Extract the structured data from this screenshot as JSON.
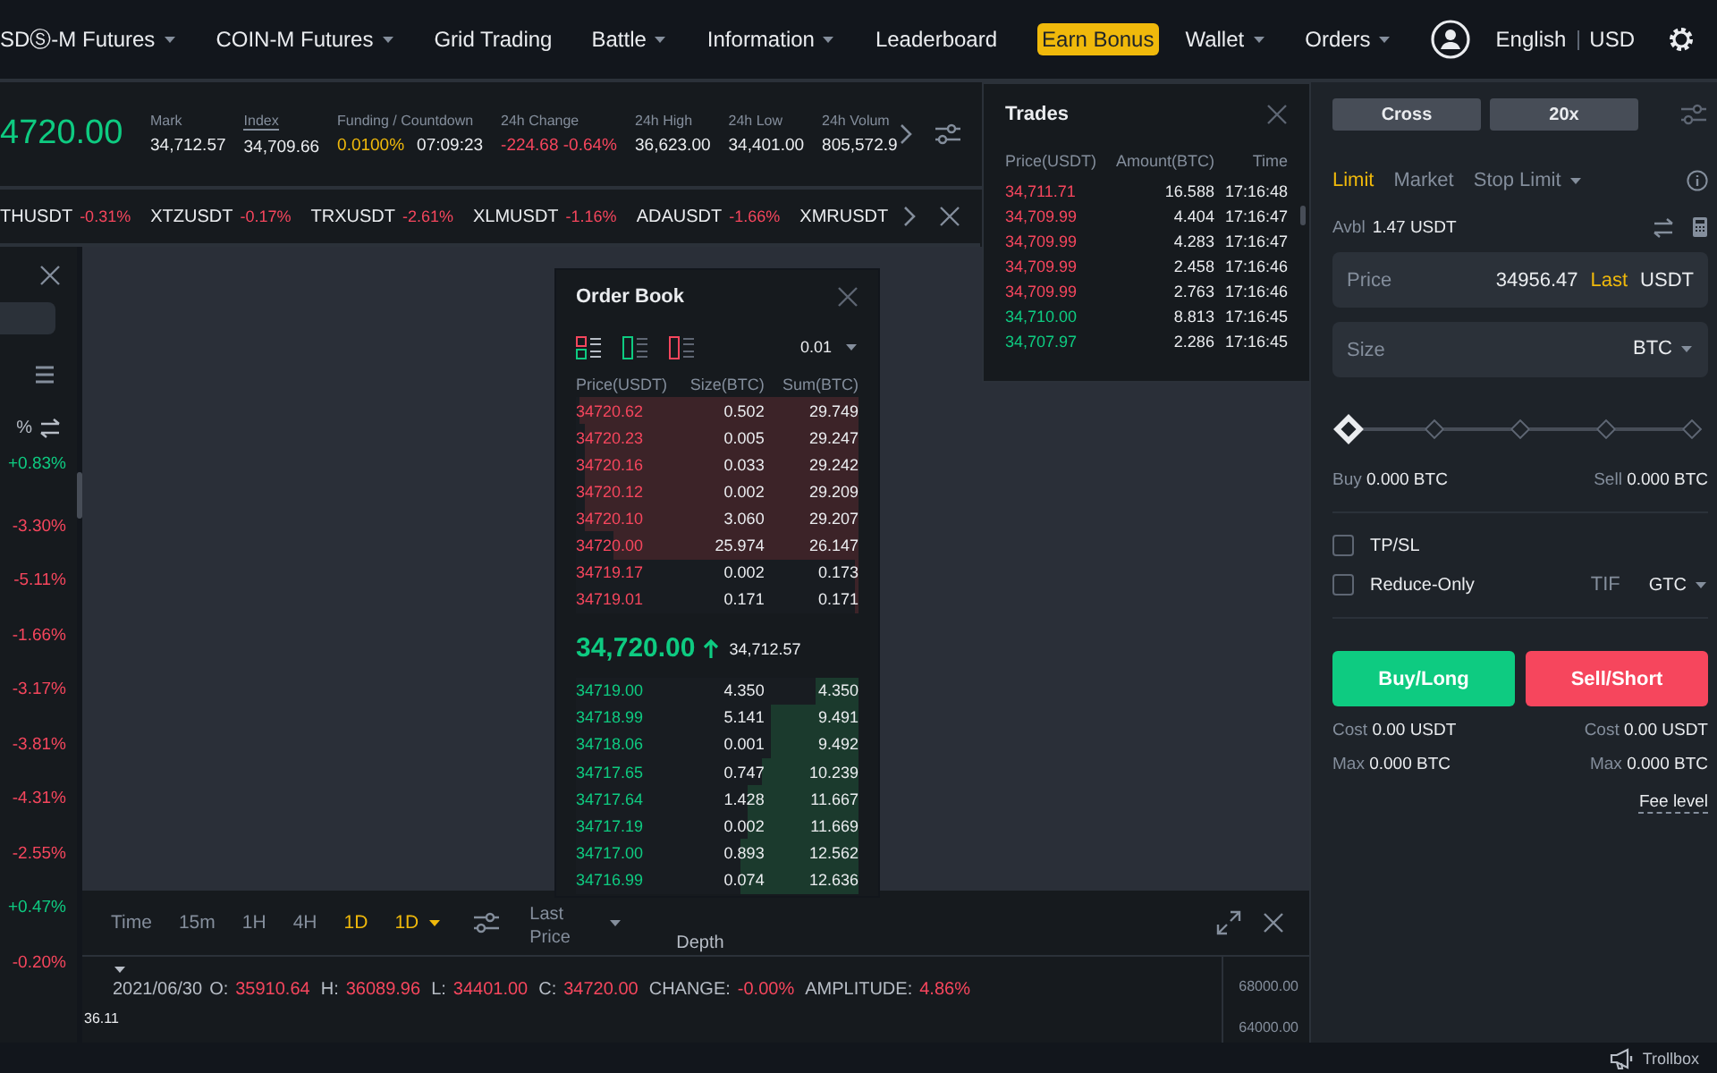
{
  "nav": {
    "items": [
      {
        "label": "SDⓈ-M Futures",
        "dropdown": true,
        "kind": "link"
      },
      {
        "label": "COIN-M Futures",
        "dropdown": true,
        "kind": "link"
      },
      {
        "label": "Grid Trading",
        "dropdown": false,
        "kind": "link"
      },
      {
        "label": "Battle",
        "dropdown": true,
        "kind": "link"
      },
      {
        "label": "Information",
        "dropdown": true,
        "kind": "link"
      },
      {
        "label": "Leaderboard",
        "dropdown": false,
        "kind": "link"
      },
      {
        "label": "Earn Bonus",
        "kind": "badge"
      }
    ],
    "right": [
      {
        "label": "Wallet",
        "dropdown": true
      },
      {
        "label": "Orders",
        "dropdown": true
      }
    ],
    "language": "English",
    "currency": "USD"
  },
  "ticker": {
    "last_price": "4720.00",
    "color": "#0ecb81",
    "stats": [
      {
        "label": "Mark",
        "underlined": false,
        "values": [
          {
            "text": "34,712.57",
            "color": "#eaecef"
          }
        ]
      },
      {
        "label": "Index",
        "underlined": true,
        "values": [
          {
            "text": "34,709.66",
            "color": "#eaecef"
          }
        ]
      },
      {
        "label": "Funding / Countdown",
        "underlined": false,
        "values": [
          {
            "text": "0.0100%",
            "color": "#f0b90b"
          },
          {
            "text": "07:09:23",
            "color": "#eaecef"
          }
        ]
      },
      {
        "label": "24h Change",
        "underlined": false,
        "values": [
          {
            "text": "-224.68 -0.64%",
            "color": "#f6465d"
          }
        ]
      },
      {
        "label": "24h High",
        "underlined": false,
        "values": [
          {
            "text": "36,623.00",
            "color": "#eaecef"
          }
        ]
      },
      {
        "label": "24h Low",
        "underlined": false,
        "values": [
          {
            "text": "34,401.00",
            "color": "#eaecef"
          }
        ]
      },
      {
        "label": "24h Volum",
        "underlined": false,
        "values": [
          {
            "text": "805,572.9",
            "color": "#eaecef"
          }
        ]
      }
    ]
  },
  "symbols": [
    {
      "symbol": "THUSDT",
      "change": "-0.31%",
      "color": "#f6465d"
    },
    {
      "symbol": "XTZUSDT",
      "change": "-0.17%",
      "color": "#f6465d"
    },
    {
      "symbol": "TRXUSDT",
      "change": "-2.61%",
      "color": "#f6465d"
    },
    {
      "symbol": "XLMUSDT",
      "change": "-1.16%",
      "color": "#f6465d"
    },
    {
      "symbol": "ADAUSDT",
      "change": "-1.66%",
      "color": "#f6465d"
    },
    {
      "symbol": "XMRUSDT"
    }
  ],
  "market_list": {
    "sort_label": "%",
    "changes": [
      {
        "text": "+0.83%",
        "color": "#0ecb81"
      },
      {
        "text": "-3.30%",
        "color": "#f6465d"
      },
      {
        "text": "-5.11%",
        "color": "#f6465d"
      },
      {
        "text": "-1.66%",
        "color": "#f6465d"
      },
      {
        "text": "-3.17%",
        "color": "#f6465d"
      },
      {
        "text": "-3.81%",
        "color": "#f6465d"
      },
      {
        "text": "-4.31%",
        "color": "#f6465d"
      },
      {
        "text": "-2.55%",
        "color": "#f6465d"
      },
      {
        "text": "+0.47%",
        "color": "#0ecb81"
      },
      {
        "text": "-0.20%",
        "color": "#f6465d"
      }
    ]
  },
  "chart": {
    "intervals": [
      {
        "label": "Time",
        "selected": false,
        "dropdown": false
      },
      {
        "label": "15m",
        "selected": false,
        "dropdown": false
      },
      {
        "label": "1H",
        "selected": false,
        "dropdown": false
      },
      {
        "label": "4H",
        "selected": false,
        "dropdown": false
      },
      {
        "label": "1D",
        "selected": true,
        "dropdown": false
      },
      {
        "label": "1D",
        "selected": true,
        "dropdown": true
      }
    ],
    "price_type": "Last Price",
    "view": "Depth",
    "info": [
      {
        "label": "2021/06/30"
      },
      {
        "label": "O:",
        "value": "35910.64"
      },
      {
        "label": "H:",
        "value": "36089.96"
      },
      {
        "label": "L:",
        "value": "34401.00"
      },
      {
        "label": "C:",
        "value": "34720.00"
      },
      {
        "label": "CHANGE:",
        "value": "-0.00%"
      },
      {
        "label": "AMPLITUDE:",
        "value": "4.86%"
      }
    ],
    "y_axis": [
      "68000.00",
      "64000.00"
    ],
    "price_marker": "36.11"
  },
  "trades": {
    "title": "Trades",
    "columns": [
      "Price(USDT)",
      "Amount(BTC)",
      "Time"
    ],
    "rows": [
      {
        "price": "34,711.71",
        "amount": "16.588",
        "time": "17:16:48",
        "color": "#f6465d"
      },
      {
        "price": "34,709.99",
        "amount": "4.404",
        "time": "17:16:47",
        "color": "#f6465d"
      },
      {
        "price": "34,709.99",
        "amount": "4.283",
        "time": "17:16:47",
        "color": "#f6465d"
      },
      {
        "price": "34,709.99",
        "amount": "2.458",
        "time": "17:16:46",
        "color": "#f6465d"
      },
      {
        "price": "34,709.99",
        "amount": "2.763",
        "time": "17:16:46",
        "color": "#f6465d"
      },
      {
        "price": "34,710.00",
        "amount": "8.813",
        "time": "17:16:45",
        "color": "#0ecb81"
      },
      {
        "price": "34,707.97",
        "amount": "2.286",
        "time": "17:16:45",
        "color": "#0ecb81"
      }
    ]
  },
  "order_book": {
    "title": "Order Book",
    "precision": "0.01",
    "columns": [
      "Price(USDT)",
      "Size(BTC)",
      "Sum(BTC)"
    ],
    "asks": [
      {
        "price": "34720.62",
        "size": "0.502",
        "sum": "29.749",
        "level": 0.99
      },
      {
        "price": "34720.23",
        "size": "0.005",
        "sum": "29.247",
        "level": 0.97
      },
      {
        "price": "34720.16",
        "size": "0.033",
        "sum": "29.242",
        "level": 0.97
      },
      {
        "price": "34720.12",
        "size": "0.002",
        "sum": "29.209",
        "level": 0.97
      },
      {
        "price": "34720.10",
        "size": "3.060",
        "sum": "29.207",
        "level": 0.97
      },
      {
        "price": "34720.00",
        "size": "25.974",
        "sum": "26.147",
        "level": 0.87
      },
      {
        "price": "34719.17",
        "size": "0.002",
        "sum": "0.173",
        "level": 0.01
      },
      {
        "price": "34719.01",
        "size": "0.171",
        "sum": "0.171",
        "level": 0.01
      }
    ],
    "last_price": "34,720.00",
    "rising": true,
    "mark_price": "34,712.57",
    "bids": [
      {
        "price": "34719.00",
        "size": "4.350",
        "sum": "4.350",
        "level": 0.15
      },
      {
        "price": "34718.99",
        "size": "5.141",
        "sum": "9.491",
        "level": 0.31
      },
      {
        "price": "34718.06",
        "size": "0.001",
        "sum": "9.492",
        "level": 0.31
      },
      {
        "price": "34717.65",
        "size": "0.747",
        "sum": "10.239",
        "level": 0.34
      },
      {
        "price": "34717.64",
        "size": "1.428",
        "sum": "11.667",
        "level": 0.39
      },
      {
        "price": "34717.19",
        "size": "0.002",
        "sum": "11.669",
        "level": 0.39
      },
      {
        "price": "34717.00",
        "size": "0.893",
        "sum": "12.562",
        "level": 0.42
      },
      {
        "price": "34716.99",
        "size": "0.074",
        "sum": "12.636",
        "level": 0.42
      }
    ]
  },
  "order_form": {
    "margin_mode": "Cross",
    "leverage": "20x",
    "tabs": [
      {
        "label": "Limit",
        "selected": true,
        "dropdown": false
      },
      {
        "label": "Market",
        "selected": false,
        "dropdown": false
      },
      {
        "label": "Stop Limit",
        "selected": false,
        "dropdown": true
      }
    ],
    "available_label": "Avbl",
    "available": "1.47 USDT",
    "price": {
      "label": "Price",
      "value": "34956.47",
      "tag": "Last",
      "unit": "USDT"
    },
    "size": {
      "placeholder": "Size",
      "unit": "BTC"
    },
    "slider": {
      "level": 0
    },
    "amounts": [
      {
        "label": "Buy",
        "value": "0.000 BTC"
      },
      {
        "label": "Sell",
        "value": "0.000 BTC"
      }
    ],
    "options": [
      {
        "label": "TP/SL",
        "checked": false
      },
      {
        "label": "Reduce-Only",
        "checked": false
      }
    ],
    "tif": {
      "label": "TIF",
      "value": "GTC"
    },
    "buttons": [
      {
        "label": "Buy/Long",
        "kind": "buy"
      },
      {
        "label": "Sell/Short",
        "kind": "sell"
      }
    ],
    "costs": [
      {
        "label": "Cost",
        "value": "0.00 USDT"
      },
      {
        "label": "Cost",
        "value": "0.00 USDT"
      }
    ],
    "maxes": [
      {
        "label": "Max",
        "value": "0.000 BTC"
      },
      {
        "label": "Max",
        "value": "0.000 BTC"
      }
    ],
    "fee_link": "Fee level"
  },
  "status_bar": {
    "trollbox": "Trollbox"
  }
}
